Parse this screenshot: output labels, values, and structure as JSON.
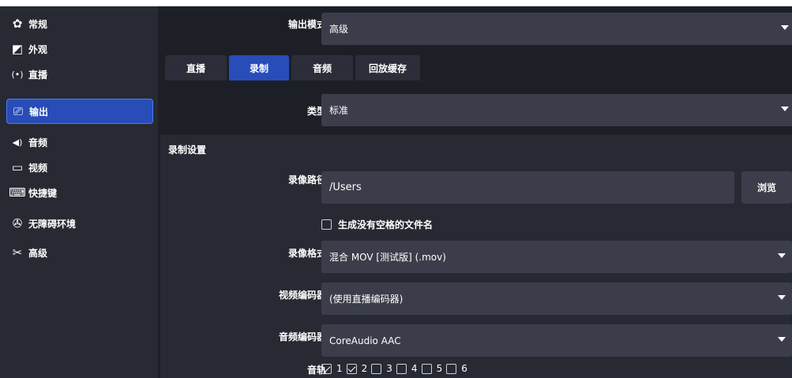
{
  "sidebar": {
    "items": [
      {
        "label": "常规",
        "icon": "gear-icon",
        "glyph": "✿"
      },
      {
        "label": "外观",
        "icon": "appearance-icon",
        "glyph": "◩"
      },
      {
        "label": "直播",
        "icon": "antenna-icon",
        "glyph": "(•)"
      },
      {
        "label": "输出",
        "icon": "output-icon",
        "glyph": "⎚",
        "active": true
      },
      {
        "label": "音频",
        "icon": "speaker-icon",
        "glyph": "◀)"
      },
      {
        "label": "视频",
        "icon": "monitor-icon",
        "glyph": "▭"
      },
      {
        "label": "快捷键",
        "icon": "keyboard-icon",
        "glyph": "⌨"
      },
      {
        "label": "无障碍环境",
        "icon": "accessibility-icon",
        "glyph": "✇"
      },
      {
        "label": "高级",
        "icon": "tools-icon",
        "glyph": "✂"
      }
    ]
  },
  "main": {
    "output_mode_label": "输出模式",
    "output_mode_value": "高级",
    "tabs": [
      {
        "label": "直播"
      },
      {
        "label": "录制",
        "active": true
      },
      {
        "label": "音频"
      },
      {
        "label": "回放缓存"
      }
    ],
    "type_label": "类型",
    "type_value": "标准",
    "section_title": "录制设置",
    "path_label": "录像路径",
    "path_value": "/Users",
    "browse_label": "浏览",
    "nospace_label": "生成没有空格的文件名",
    "format_label": "录像格式",
    "format_value": "混合 MOV [测试版] (.mov)",
    "video_encoder_label": "视频编码器",
    "video_encoder_value": "(使用直播编码器)",
    "audio_encoder_label": "音频编码器",
    "audio_encoder_value": "CoreAudio AAC",
    "tracks_label": "音轨",
    "tracks": [
      {
        "num": "1",
        "checked": true
      },
      {
        "num": "2",
        "checked": true
      },
      {
        "num": "3",
        "checked": false
      },
      {
        "num": "4",
        "checked": false
      },
      {
        "num": "5",
        "checked": false
      },
      {
        "num": "6",
        "checked": false
      }
    ]
  },
  "colors": {
    "accent": "#284cb8",
    "background": "#1d1f26",
    "panel": "#272a33",
    "field": "#3b3e4a"
  }
}
